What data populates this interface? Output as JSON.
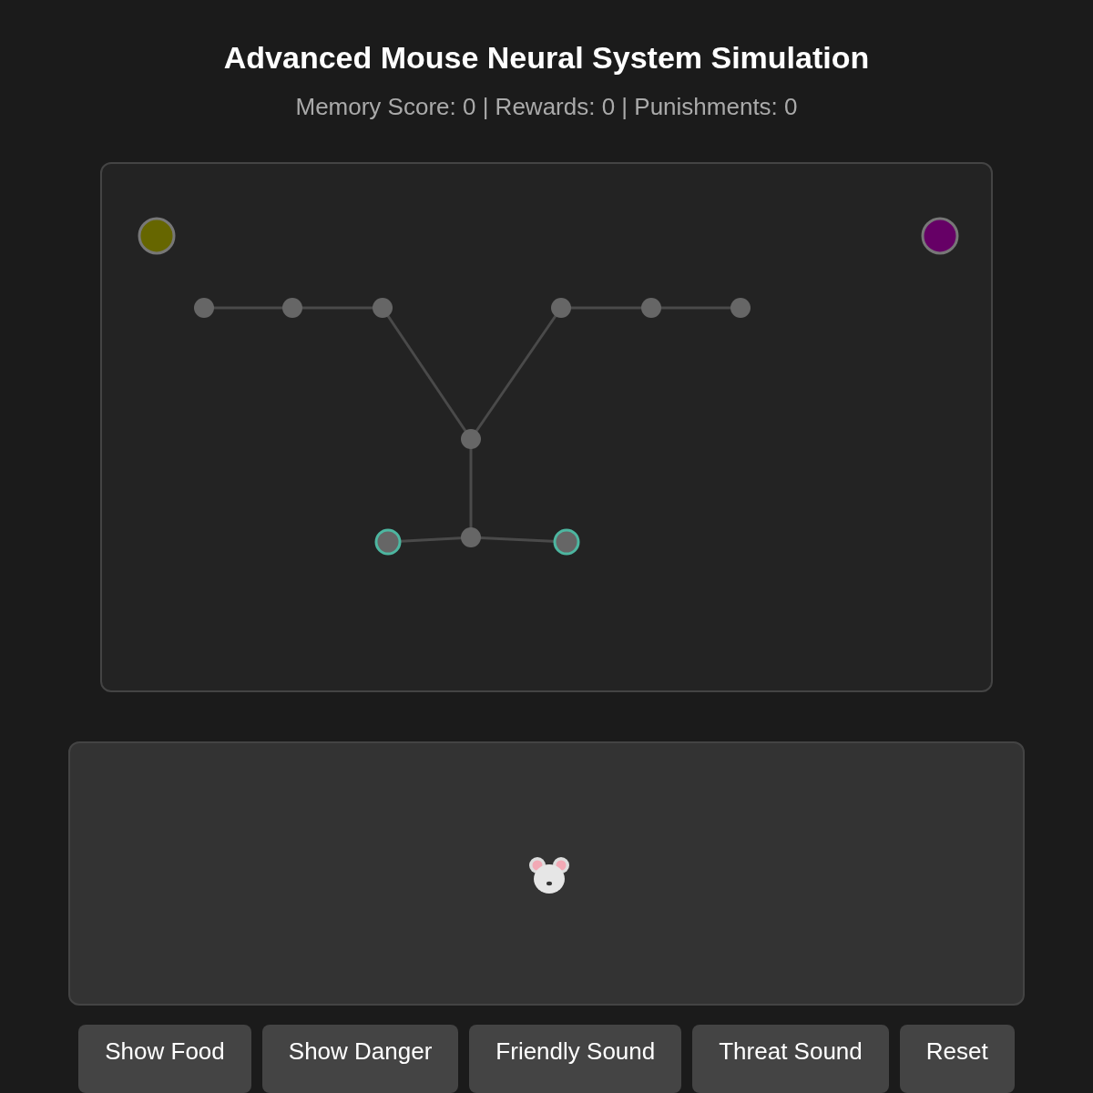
{
  "title": "Advanced Mouse Neural System Simulation",
  "stats": "Memory Score: 0 | Rewards: 0 | Punishments: 0",
  "stimuli": [
    {
      "color": "#666600"
    },
    {
      "color": "#660066"
    }
  ],
  "neurons": [
    {
      "active": false
    },
    {
      "active": false
    },
    {
      "active": false
    },
    {
      "active": false
    },
    {
      "active": false
    },
    {
      "active": false
    },
    {
      "active": false
    },
    {
      "active": true
    },
    {
      "active": false
    },
    {
      "active": true
    }
  ],
  "buttons": [
    "Show Food",
    "Show Danger",
    "Friendly Sound",
    "Threat Sound",
    "Reset"
  ]
}
